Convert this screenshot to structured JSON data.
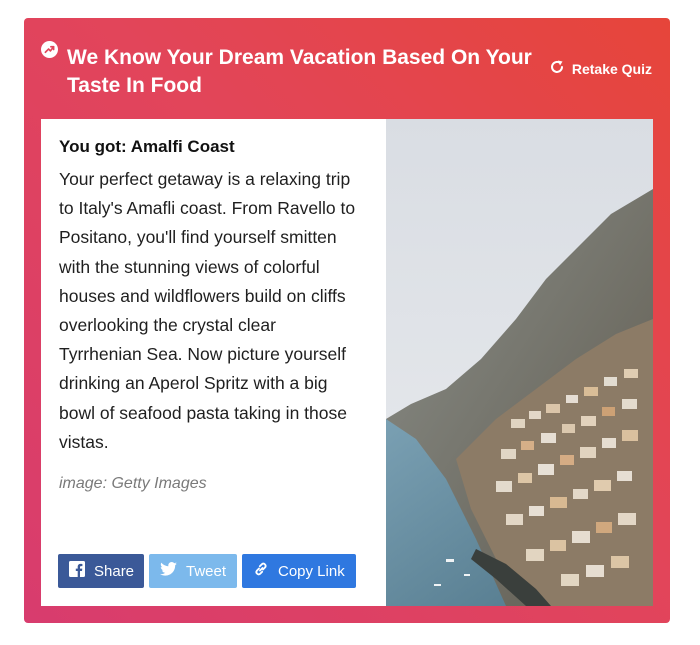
{
  "quiz": {
    "title": "We Know Your Dream Vacation Based On Your Taste In Food",
    "retake_label": "Retake Quiz"
  },
  "result": {
    "heading": "You got: Amalfi Coast",
    "description": "Your perfect getaway is a relaxing trip to Italy's Amafli coast. From Ravello to Positano, you'll find yourself smitten with the stunning views of colorful houses and wildflowers build on cliffs overlooking the crystal clear Tyrrhenian Sea. Now picture yourself drinking an Aperol Spritz with a big bowl of seafood pasta taking in those vistas.",
    "image_credit": "image: Getty Images",
    "image_subject": "Amalfi coast cliffside town above the sea"
  },
  "share": {
    "facebook_label": "Share",
    "twitter_label": "Tweet",
    "copy_link_label": "Copy Link"
  },
  "icons": {
    "trending": "trending-icon",
    "retake": "refresh-icon",
    "facebook": "facebook-icon",
    "twitter": "twitter-icon",
    "copy_link": "link-icon"
  },
  "colors": {
    "card_gradient_start": "#e6453a",
    "card_gradient_end": "#d83c6e",
    "facebook": "#3b5998",
    "twitter": "#7cb9ec",
    "copy_link": "#2f78e0"
  }
}
